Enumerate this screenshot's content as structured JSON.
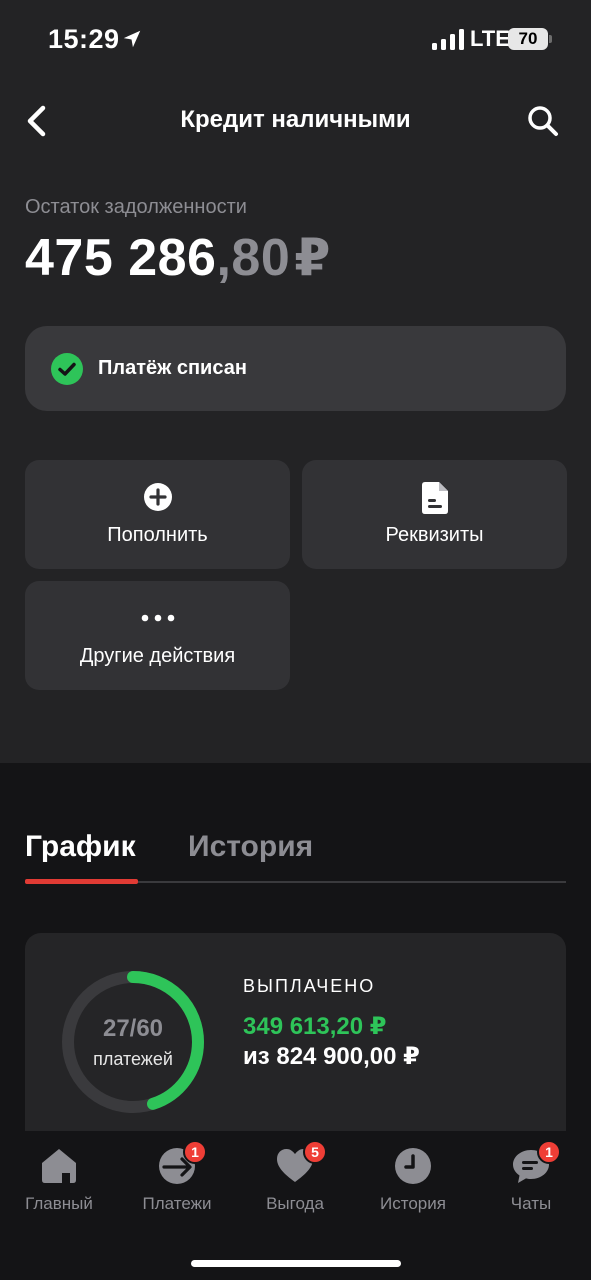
{
  "status_bar": {
    "time": "15:29",
    "network": "LTE",
    "battery": "70"
  },
  "header": {
    "title": "Кредит наличными"
  },
  "balance": {
    "label": "Остаток задолженности",
    "integer": "475 286",
    "fraction": ",80",
    "currency": "₽"
  },
  "status_card": {
    "text": "Платёж списан"
  },
  "actions": [
    {
      "label": "Пополнить",
      "icon": "plus-circle-icon"
    },
    {
      "label": "Реквизиты",
      "icon": "document-icon"
    },
    {
      "label": "Другие действия",
      "icon": "more-dots-icon"
    }
  ],
  "tabs": [
    {
      "label": "График",
      "active": true
    },
    {
      "label": "История",
      "active": false
    }
  ],
  "schedule": {
    "payments_done": "27/60",
    "payments_label": "платежей",
    "progress": 0.45,
    "paid_label": "ВЫПЛАЧЕНО",
    "paid_amount": "349 613,20 ₽",
    "total_amount": "из 824 900,00 ₽"
  },
  "bottom_nav": [
    {
      "label": "Главный",
      "icon": "home-icon",
      "badge": ""
    },
    {
      "label": "Платежи",
      "icon": "payments-icon",
      "badge": "1"
    },
    {
      "label": "Выгода",
      "icon": "heart-icon",
      "badge": "5"
    },
    {
      "label": "История",
      "icon": "clock-icon",
      "badge": ""
    },
    {
      "label": "Чаты",
      "icon": "chat-icon",
      "badge": "1"
    }
  ],
  "colors": {
    "accent_red": "#e13b34",
    "success_green": "#2ec459",
    "badge_red": "#ef3e36"
  }
}
